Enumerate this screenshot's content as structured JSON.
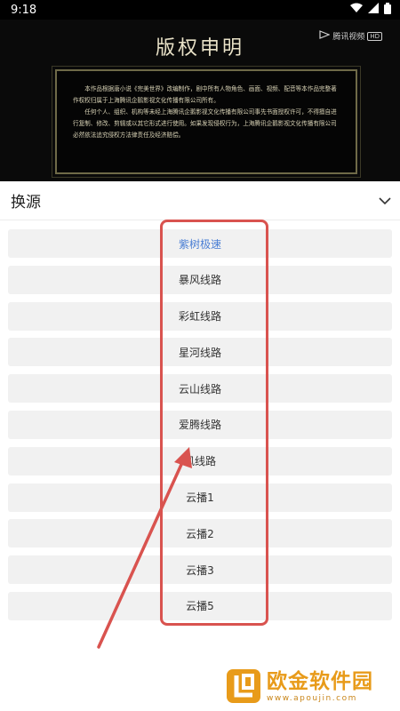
{
  "status_bar": {
    "time": "9:18",
    "icons": [
      "wifi-icon",
      "signal-icon",
      "battery-icon"
    ]
  },
  "video": {
    "title": "版权申明",
    "watermark": {
      "brand": "腾讯视频",
      "tag": "HD"
    },
    "notice": {
      "paragraph1": "本作品根据唐小说《完美世界》改编制作，剧中所有人物角色、画面、视频、配音等本作品完整著作权权归属于上海腾讯企鹅影视文化传播有限公司所有。",
      "paragraph2": "任何个人、组织、机构等未经上海腾讯企鹅影视文化传播有限公司事先书面授权许可，不得擅自进行复制、修改、剪辑或以其它形式进行使用。如果发现侵权行为，上海腾讯企鹅影视文化传播有限公司必然依法追究侵权方法律责任及经济赔偿。"
    }
  },
  "sheet": {
    "title": "换源",
    "collapse_icon": "chevron-down-icon"
  },
  "sources": [
    {
      "label": "紫树极速",
      "active": true
    },
    {
      "label": "暴风线路",
      "active": false
    },
    {
      "label": "彩虹线路",
      "active": false
    },
    {
      "label": "星河线路",
      "active": false
    },
    {
      "label": "云山线路",
      "active": false
    },
    {
      "label": "爱腾线路",
      "active": false
    },
    {
      "label": "风线路",
      "active": false
    },
    {
      "label": "云播1",
      "active": false
    },
    {
      "label": "云播2",
      "active": false
    },
    {
      "label": "云播3",
      "active": false
    },
    {
      "label": "云播5",
      "active": false
    }
  ],
  "annotation": {
    "color": "#d9534f"
  },
  "logo": {
    "name": "欧金软件园",
    "url": "www.apoujin.com",
    "color": "#e89b1a"
  }
}
